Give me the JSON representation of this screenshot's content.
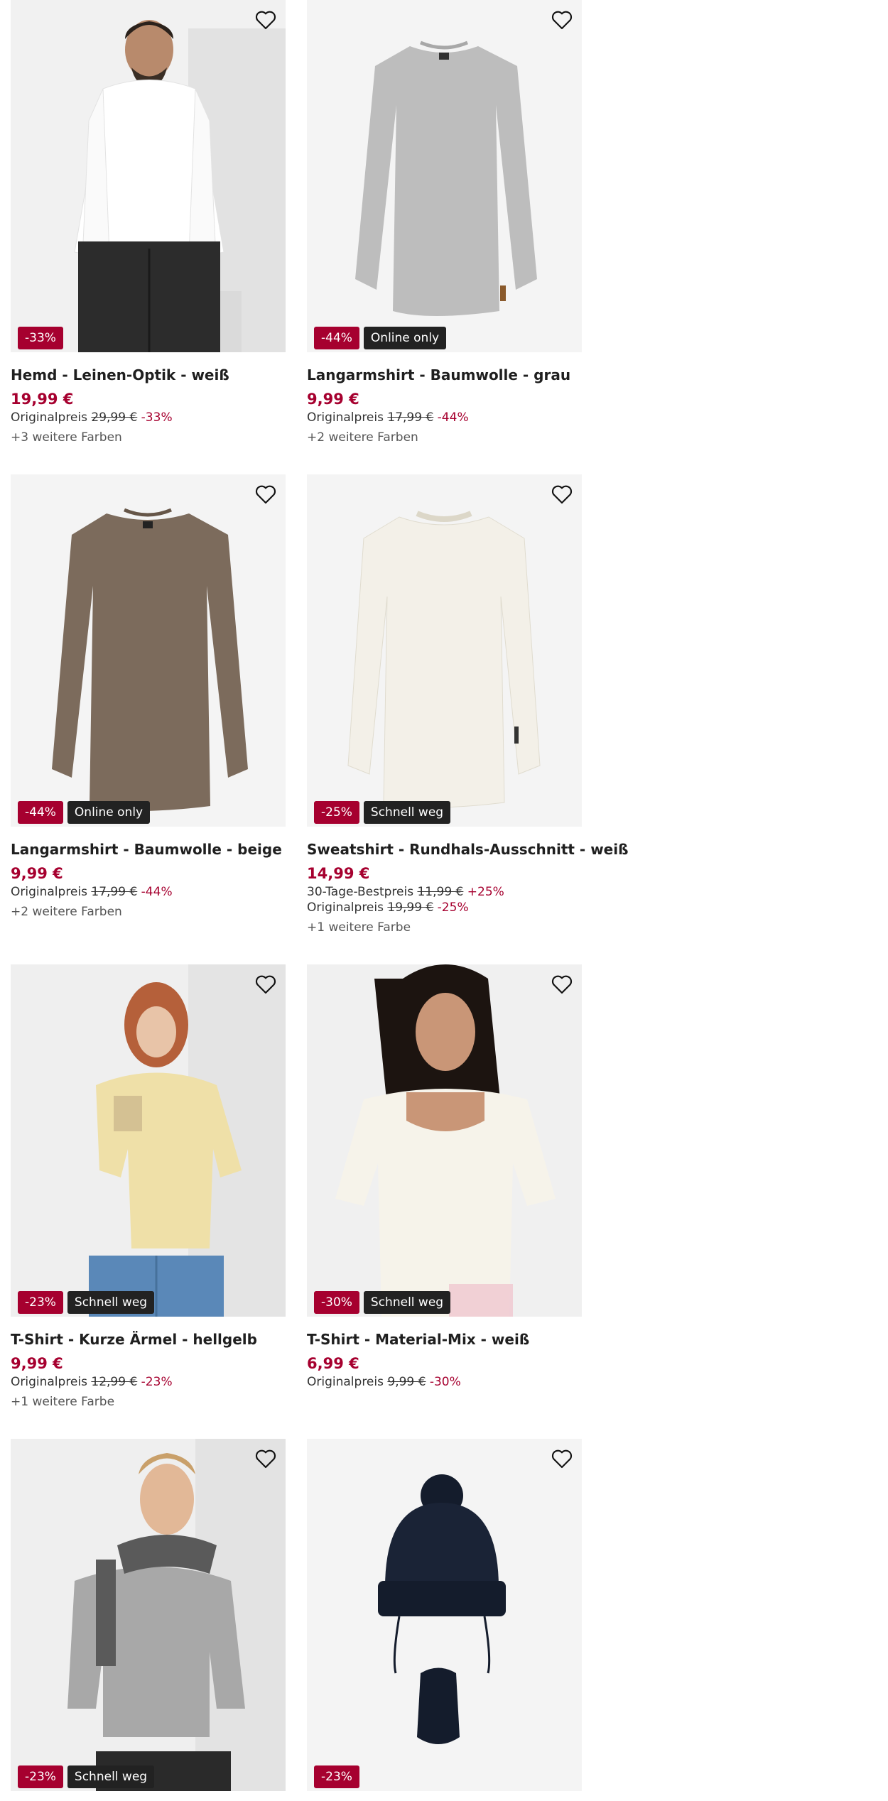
{
  "products": [
    {
      "title": "Hemd - Leinen-Optik - weiß",
      "price": "19,99 €",
      "badges": [
        {
          "text": "-33%",
          "kind": "sale"
        }
      ],
      "lines": [
        {
          "label": "Originalpreis",
          "old": "29,99 €",
          "pct": "-33%"
        }
      ],
      "colors": "+3 weitere Farben",
      "image": "man-white-shirt"
    },
    {
      "title": "Langarmshirt - Baumwolle - grau",
      "price": "9,99 €",
      "badges": [
        {
          "text": "-44%",
          "kind": "sale"
        },
        {
          "text": "Online only",
          "kind": "tag"
        }
      ],
      "lines": [
        {
          "label": "Originalpreis",
          "old": "17,99 €",
          "pct": "-44%"
        }
      ],
      "colors": "+2 weitere Farben",
      "image": "grey-longsleeve"
    },
    {
      "title": "Langarmshirt - Baumwolle - beige",
      "price": "9,99 €",
      "badges": [
        {
          "text": "-44%",
          "kind": "sale"
        },
        {
          "text": "Online only",
          "kind": "tag"
        }
      ],
      "lines": [
        {
          "label": "Originalpreis",
          "old": "17,99 €",
          "pct": "-44%"
        }
      ],
      "colors": "+2 weitere Farben",
      "image": "beige-longsleeve"
    },
    {
      "title": "Sweatshirt - Rundhals-Ausschnitt - weiß",
      "price": "14,99 €",
      "badges": [
        {
          "text": "-25%",
          "kind": "sale"
        },
        {
          "text": "Schnell weg",
          "kind": "tag"
        }
      ],
      "lines": [
        {
          "label": "30-Tage-Bestpreis",
          "old": "11,99 €",
          "pct": "+25%"
        },
        {
          "label": "Originalpreis",
          "old": "19,99 €",
          "pct": "-25%"
        }
      ],
      "colors": "+1 weitere Farbe",
      "image": "white-sweatshirt"
    },
    {
      "title": "T-Shirt - Kurze Ärmel - hellgelb",
      "price": "9,99 €",
      "badges": [
        {
          "text": "-23%",
          "kind": "sale"
        },
        {
          "text": "Schnell weg",
          "kind": "tag"
        }
      ],
      "lines": [
        {
          "label": "Originalpreis",
          "old": "12,99 €",
          "pct": "-23%"
        }
      ],
      "colors": "+1 weitere Farbe",
      "image": "woman-yellow-tshirt"
    },
    {
      "title": "T-Shirt - Material-Mix - weiß",
      "price": "6,99 €",
      "badges": [
        {
          "text": "-30%",
          "kind": "sale"
        },
        {
          "text": "Schnell weg",
          "kind": "tag"
        }
      ],
      "lines": [
        {
          "label": "Originalpreis",
          "old": "9,99 €",
          "pct": "-30%"
        }
      ],
      "colors": "",
      "image": "woman-white-tshirt"
    },
    {
      "title": "",
      "price": "",
      "badges": [
        {
          "text": "-23%",
          "kind": "sale"
        },
        {
          "text": "Schnell weg",
          "kind": "tag"
        }
      ],
      "lines": [],
      "colors": "",
      "image": "man-grey-sweater-scarf"
    },
    {
      "title": "",
      "price": "",
      "badges": [
        {
          "text": "-23%",
          "kind": "sale"
        }
      ],
      "lines": [],
      "colors": "",
      "image": "navy-beanie-mittens"
    }
  ],
  "icons": {
    "wishlist": "heart-outline-icon"
  },
  "colors": {
    "sale": "#a6002f",
    "tag": "#222222",
    "image_bg": "#f4f4f4"
  }
}
